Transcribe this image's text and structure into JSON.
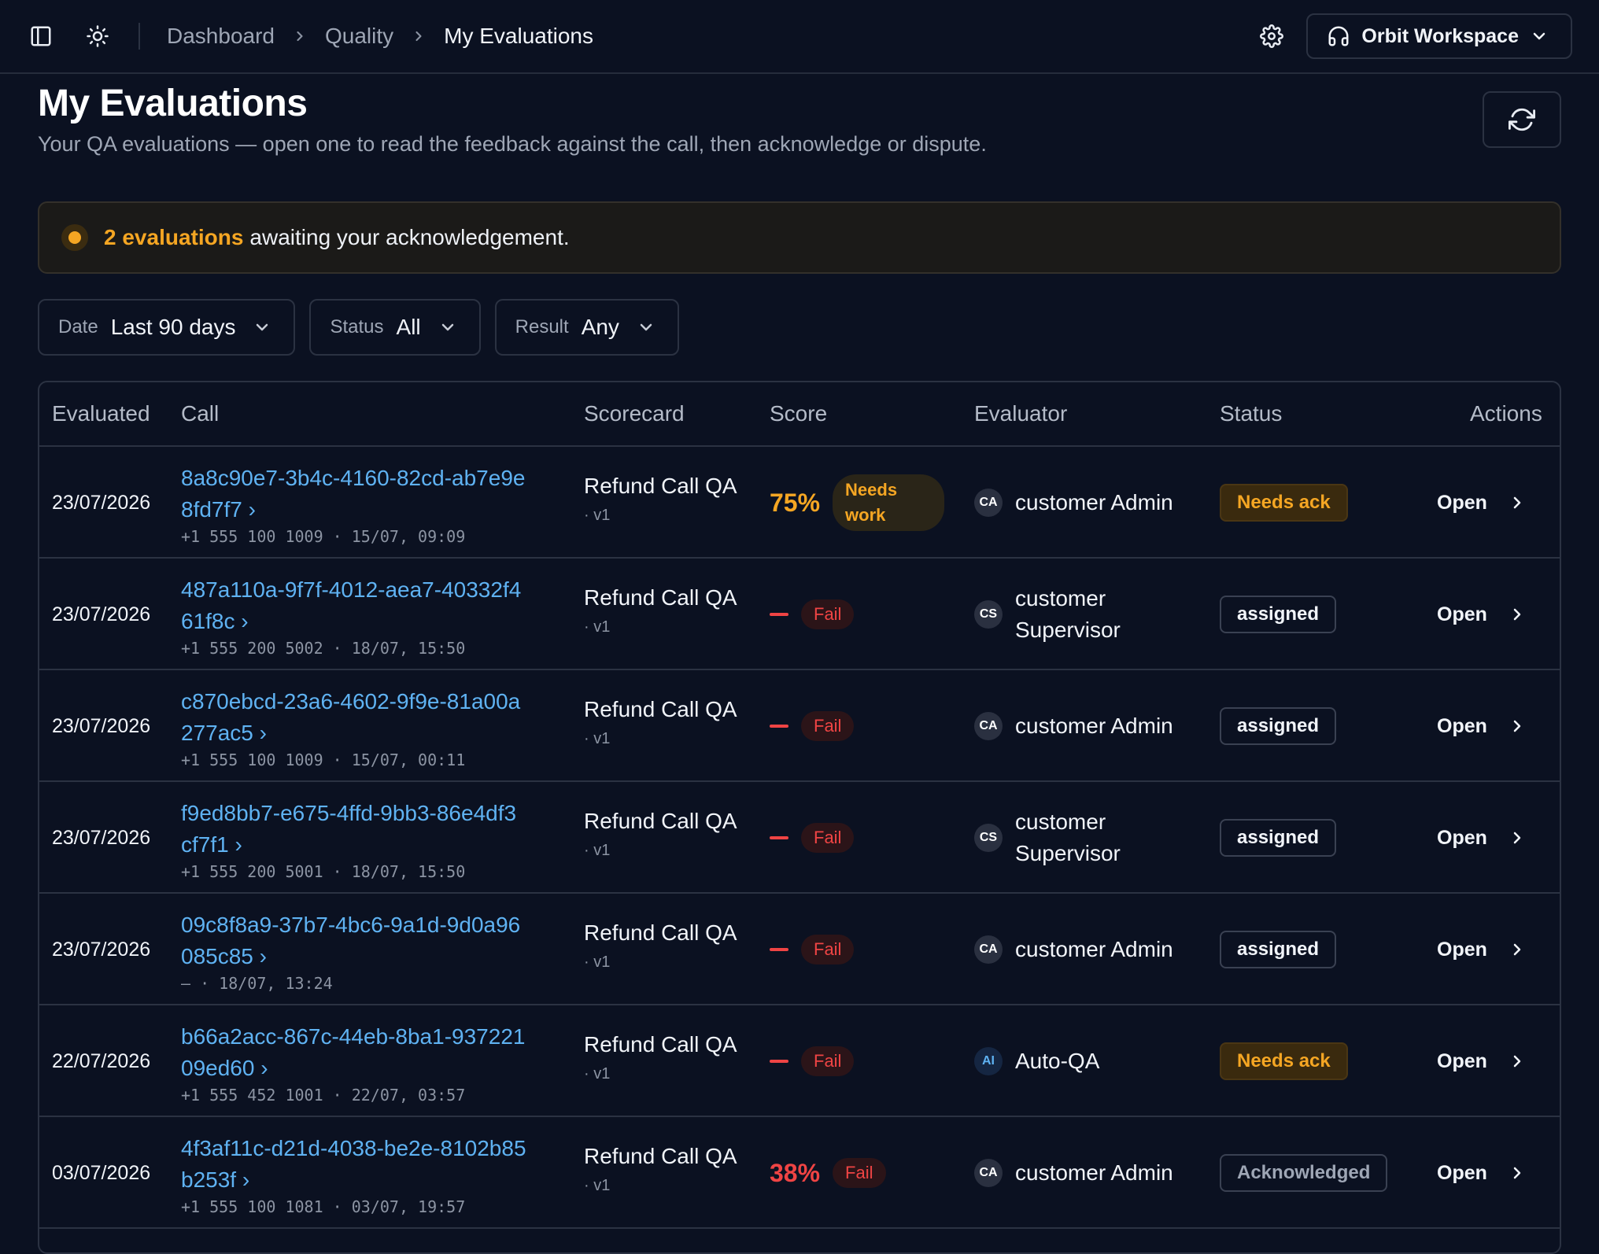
{
  "topbar": {
    "breadcrumb": [
      "Dashboard",
      "Quality",
      "My Evaluations"
    ],
    "workspace": "Orbit Workspace",
    "icons": [
      "sidebar-toggle-icon",
      "sun-icon",
      "gear-icon",
      "headset-icon",
      "chevron-down-icon"
    ]
  },
  "header": {
    "title": "My Evaluations",
    "subtitle": "Your QA evaluations — open one to read the feedback against the call, then acknowledge or dispute."
  },
  "banner": {
    "count": "2 evaluations",
    "text": "awaiting your acknowledgement."
  },
  "filters": [
    {
      "label": "Date",
      "value": "Last 90 days"
    },
    {
      "label": "Status",
      "value": "All"
    },
    {
      "label": "Result",
      "value": "Any"
    }
  ],
  "table": {
    "columns": [
      "Evaluated",
      "Call",
      "Scorecard",
      "Score",
      "Evaluator",
      "Status",
      "Actions"
    ],
    "rows": [
      {
        "date": "23/07/2026",
        "call": "8a8c90e7-3b4c-4160-82cd-ab7e9e8fd7f7 ›",
        "meta": "+1 555 100 1009 · 15/07, 09:09",
        "scorecard": "Refund Call QA",
        "version": "· v1",
        "score": "75%",
        "result": "Needs work",
        "avatar": "CA",
        "evaluator": "customer Admin",
        "status": "Needs ack",
        "action": "Open"
      },
      {
        "date": "23/07/2026",
        "call": "487a110a-9f7f-4012-aea7-40332f461f8c ›",
        "meta": "+1 555 200 5002 · 18/07, 15:50",
        "scorecard": "Refund Call QA",
        "version": "· v1",
        "score": "—",
        "result": "Fail",
        "avatar": "CS",
        "evaluator": "customer Supervisor",
        "status": "assigned",
        "action": "Open"
      },
      {
        "date": "23/07/2026",
        "call": "c870ebcd-23a6-4602-9f9e-81a00a277ac5 ›",
        "meta": "+1 555 100 1009 · 15/07, 00:11",
        "scorecard": "Refund Call QA",
        "version": "· v1",
        "score": "—",
        "result": "Fail",
        "avatar": "CA",
        "evaluator": "customer Admin",
        "status": "assigned",
        "action": "Open"
      },
      {
        "date": "23/07/2026",
        "call": "f9ed8bb7-e675-4ffd-9bb3-86e4df3cf7f1 ›",
        "meta": "+1 555 200 5001 · 18/07, 15:50",
        "scorecard": "Refund Call QA",
        "version": "· v1",
        "score": "—",
        "result": "Fail",
        "avatar": "CS",
        "evaluator": "customer Supervisor",
        "status": "assigned",
        "action": "Open"
      },
      {
        "date": "23/07/2026",
        "call": "09c8f8a9-37b7-4bc6-9a1d-9d0a96085c85 ›",
        "meta": "— · 18/07, 13:24",
        "scorecard": "Refund Call QA",
        "version": "· v1",
        "score": "—",
        "result": "Fail",
        "avatar": "CA",
        "evaluator": "customer Admin",
        "status": "assigned",
        "action": "Open"
      },
      {
        "date": "22/07/2026",
        "call": "b66a2acc-867c-44eb-8ba1-93722109ed60 ›",
        "meta": "+1 555 452 1001 · 22/07, 03:57",
        "scorecard": "Refund Call QA",
        "version": "· v1",
        "score": "—",
        "result": "Fail",
        "avatar": "AI",
        "evaluator": "Auto-QA",
        "status": "Needs ack",
        "action": "Open"
      },
      {
        "date": "03/07/2026",
        "call": "4f3af11c-d21d-4038-be2e-8102b85b253f ›",
        "meta": "+1 555 100 1081 · 03/07, 19:57",
        "scorecard": "Refund Call QA",
        "version": "· v1",
        "score": "38%",
        "result": "Fail",
        "avatar": "CA",
        "evaluator": "customer Admin",
        "status": "Acknowledged",
        "action": "Open"
      }
    ]
  },
  "colors": {
    "background": "#0b1121",
    "link": "#5fb2f2",
    "warning": "#f5a623",
    "fail": "#ef4444"
  }
}
